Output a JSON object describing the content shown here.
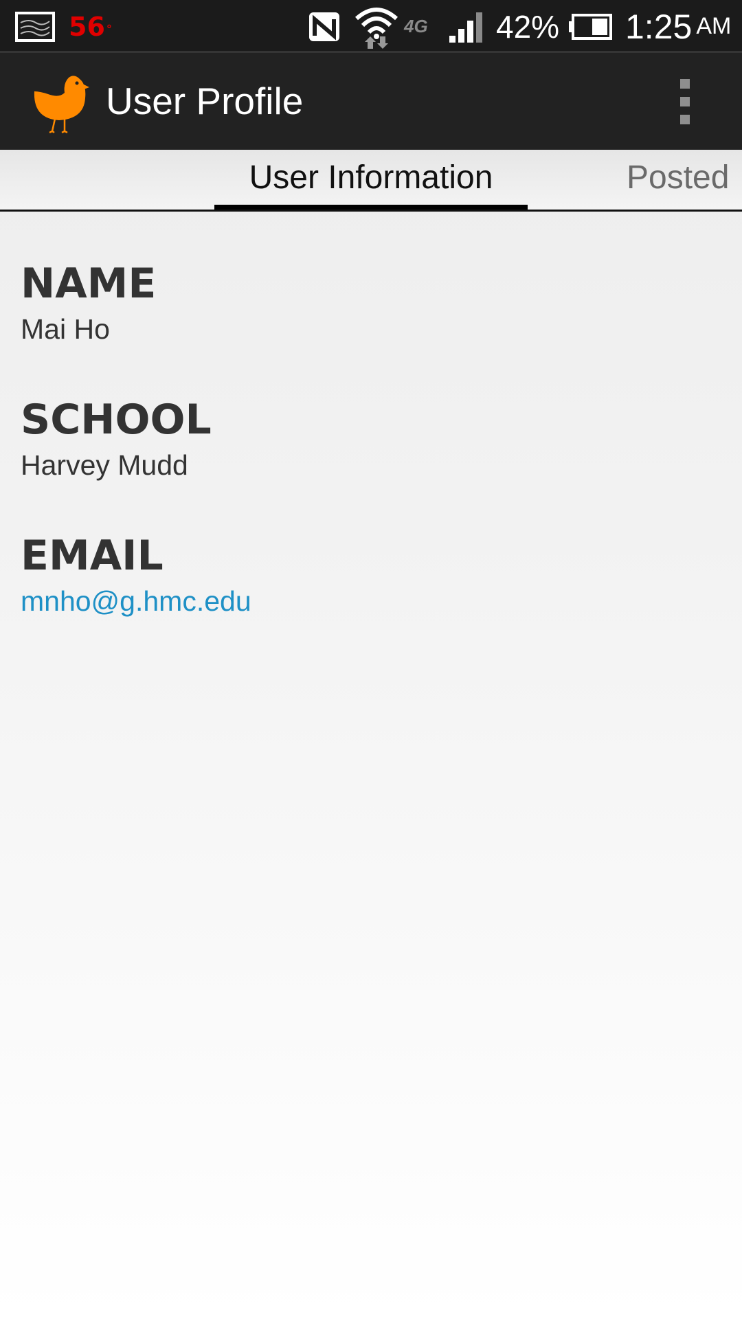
{
  "status_bar": {
    "temperature": "56",
    "temperature_unit": "°",
    "network": "4G",
    "battery": "42%",
    "time": "1:25",
    "ampm": "AM",
    "icons": [
      "gallery-icon",
      "nfc-icon",
      "wifi-icon",
      "lte-icon",
      "signal-icon",
      "battery-icon"
    ]
  },
  "action_bar": {
    "title": "User Profile",
    "logo": "bird-logo",
    "menu_icon": "overflow-menu-icon"
  },
  "tabs": [
    {
      "label": "User Information",
      "selected": true
    },
    {
      "label": "Posted",
      "selected": false
    }
  ],
  "profile": {
    "name_label": "NAME",
    "name_value": "Mai Ho",
    "school_label": "SCHOOL",
    "school_value": "Harvey Mudd",
    "email_label": "EMAIL",
    "email_value": "mnho@g.hmc.edu"
  },
  "colors": {
    "accent_orange": "#ff8a00",
    "link_blue": "#1e90c6",
    "temperature_red": "#e00000",
    "action_bar_bg": "#222222"
  }
}
